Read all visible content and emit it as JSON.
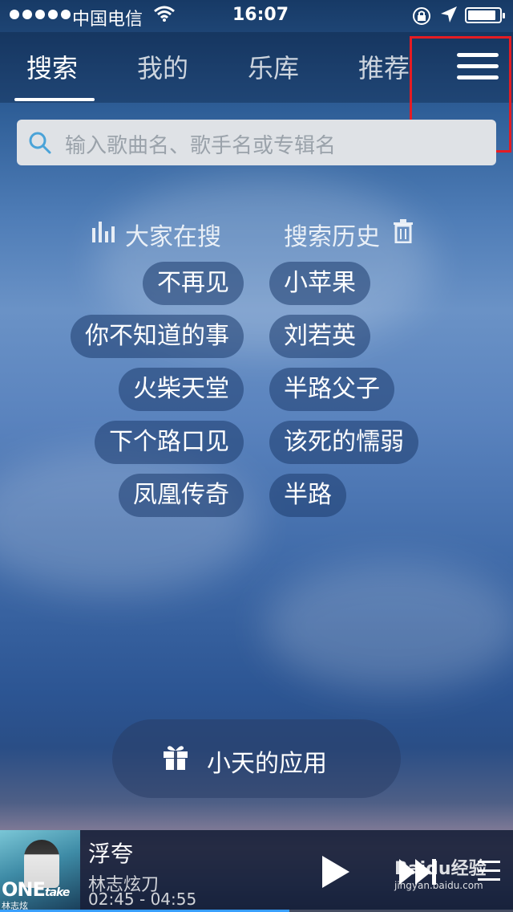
{
  "status_bar": {
    "carrier": "中国电信",
    "time": "16:07",
    "battery_level": 0.9
  },
  "nav": {
    "tabs": [
      {
        "label": "搜索",
        "active": true
      },
      {
        "label": "我的",
        "active": false
      },
      {
        "label": "乐库",
        "active": false
      },
      {
        "label": "推荐",
        "active": false
      }
    ],
    "menu_icon": "hamburger-menu-icon"
  },
  "search": {
    "placeholder": "输入歌曲名、歌手名或专辑名"
  },
  "hot_searches": {
    "title": "大家在搜",
    "items": [
      "不再见",
      "你不知道的事",
      "火柴天堂",
      "下个路口见",
      "凤凰传奇"
    ]
  },
  "search_history": {
    "title": "搜索历史",
    "items": [
      "小苹果",
      "刘若英",
      "半路父子",
      "该死的懦弱",
      "半路"
    ]
  },
  "app_button": {
    "label": "小天的应用",
    "icon": "gift-icon"
  },
  "player": {
    "title": "浮夸",
    "artist": "林志炫刀",
    "time": "02:45 - 04:55",
    "progress": 0.5636,
    "album_text": "ONE",
    "album_text_script": "take",
    "album_subtitle": "林志炫"
  },
  "colors": {
    "highlight": "#e51c23",
    "progress": "#3aa0ff"
  },
  "watermark": {
    "main": "Baidu经验",
    "sub": "jingyan.baidu.com"
  }
}
